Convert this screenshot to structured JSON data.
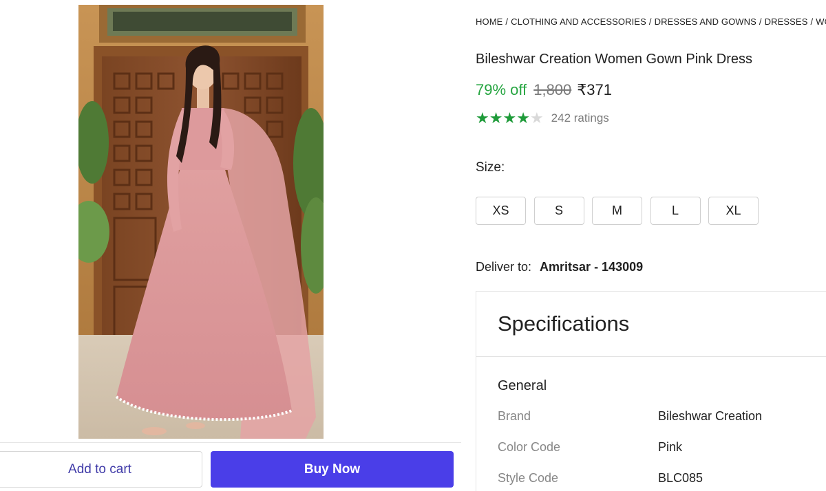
{
  "breadcrumb": [
    "HOME",
    "CLOTHING AND ACCESSORIES",
    "DRESSES AND GOWNS",
    "DRESSES",
    "WOMEN"
  ],
  "product": {
    "title": "Bileshwar Creation Women Gown Pink Dress",
    "discount": "79% off",
    "mrp": "1,800",
    "price": "₹371",
    "rating_value": 4,
    "rating_max": 5,
    "ratings_count": "242 ratings"
  },
  "size": {
    "label": "Size:",
    "options": [
      "XS",
      "S",
      "M",
      "L",
      "XL"
    ]
  },
  "delivery": {
    "label": "Deliver to:",
    "location": "Amritsar - 143009"
  },
  "specifications": {
    "heading": "Specifications",
    "group": "General",
    "rows": [
      {
        "key": "Brand",
        "value": "Bileshwar Creation"
      },
      {
        "key": "Color Code",
        "value": "Pink"
      },
      {
        "key": "Style Code",
        "value": "BLC085"
      }
    ]
  },
  "actions": {
    "add_to_cart": "Add to cart",
    "buy_now": "Buy Now"
  },
  "colors": {
    "discount_green": "#26a541",
    "star_green": "#1f9b3a",
    "buy_button": "#4a3ee8",
    "cart_text": "#3f3aa8"
  }
}
